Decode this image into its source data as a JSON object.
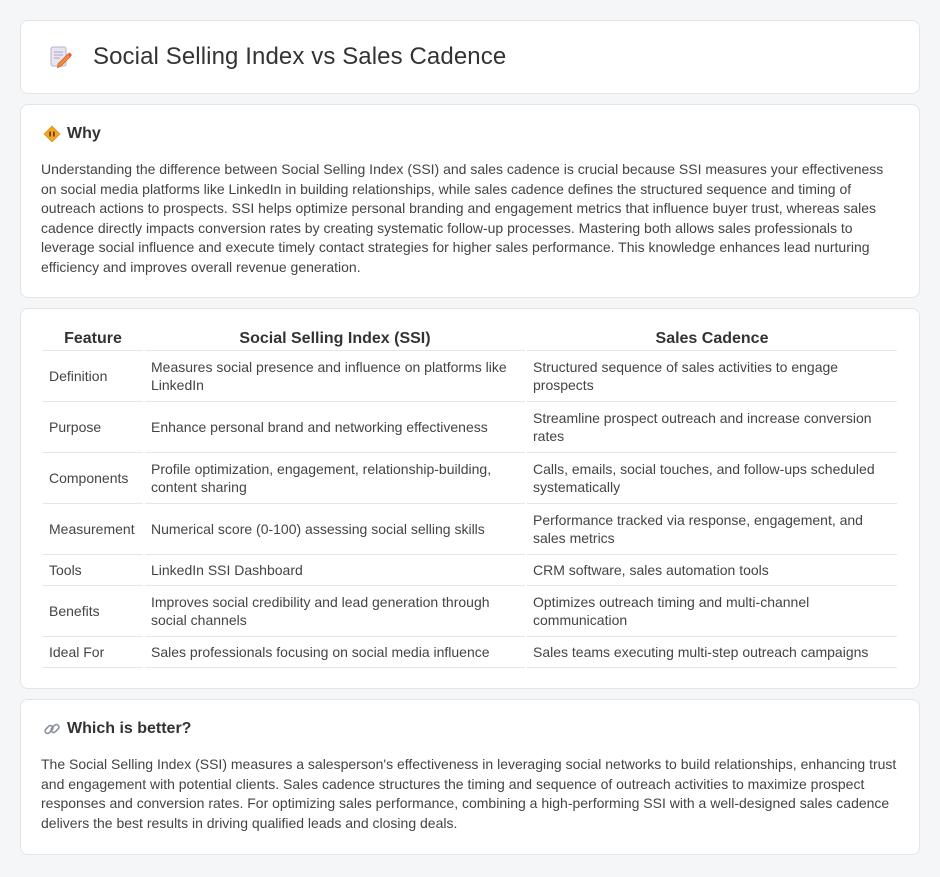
{
  "header": {
    "title": "Social Selling Index vs Sales Cadence",
    "icon": "document-pencil-icon"
  },
  "why": {
    "title": "Why",
    "icon": "diamond-sign-icon",
    "body": "Understanding the difference between Social Selling Index (SSI) and sales cadence is crucial because SSI measures your effectiveness on social media platforms like LinkedIn in building relationships, while sales cadence defines the structured sequence and timing of outreach actions to prospects. SSI helps optimize personal branding and engagement metrics that influence buyer trust, whereas sales cadence directly impacts conversion rates by creating systematic follow-up processes. Mastering both allows sales professionals to leverage social influence and execute timely contact strategies for higher sales performance. This knowledge enhances lead nurturing efficiency and improves overall revenue generation."
  },
  "table": {
    "headers": [
      "Feature",
      "Social Selling Index (SSI)",
      "Sales Cadence"
    ],
    "rows": [
      [
        "Definition",
        "Measures social presence and influence on platforms like LinkedIn",
        "Structured sequence of sales activities to engage prospects"
      ],
      [
        "Purpose",
        "Enhance personal brand and networking effectiveness",
        "Streamline prospect outreach and increase conversion rates"
      ],
      [
        "Components",
        "Profile optimization, engagement, relationship-building, content sharing",
        "Calls, emails, social touches, and follow-ups scheduled systematically"
      ],
      [
        "Measurement",
        "Numerical score (0-100) assessing social selling skills",
        "Performance tracked via response, engagement, and sales metrics"
      ],
      [
        "Tools",
        "LinkedIn SSI Dashboard",
        "CRM software, sales automation tools"
      ],
      [
        "Benefits",
        "Improves social credibility and lead generation through social channels",
        "Optimizes outreach timing and multi-channel communication"
      ],
      [
        "Ideal For",
        "Sales professionals focusing on social media influence",
        "Sales teams executing multi-step outreach campaigns"
      ]
    ]
  },
  "which": {
    "title": "Which is better?",
    "icon": "link-icon",
    "body": "The Social Selling Index (SSI) measures a salesperson's effectiveness in leveraging social networks to build relationships, enhancing trust and engagement with potential clients. Sales cadence structures the timing and sequence of outreach activities to maximize prospect responses and conversion rates. For optimizing sales performance, combining a high-performing SSI with a well-designed sales cadence delivers the best results in driving qualified leads and closing deals."
  }
}
